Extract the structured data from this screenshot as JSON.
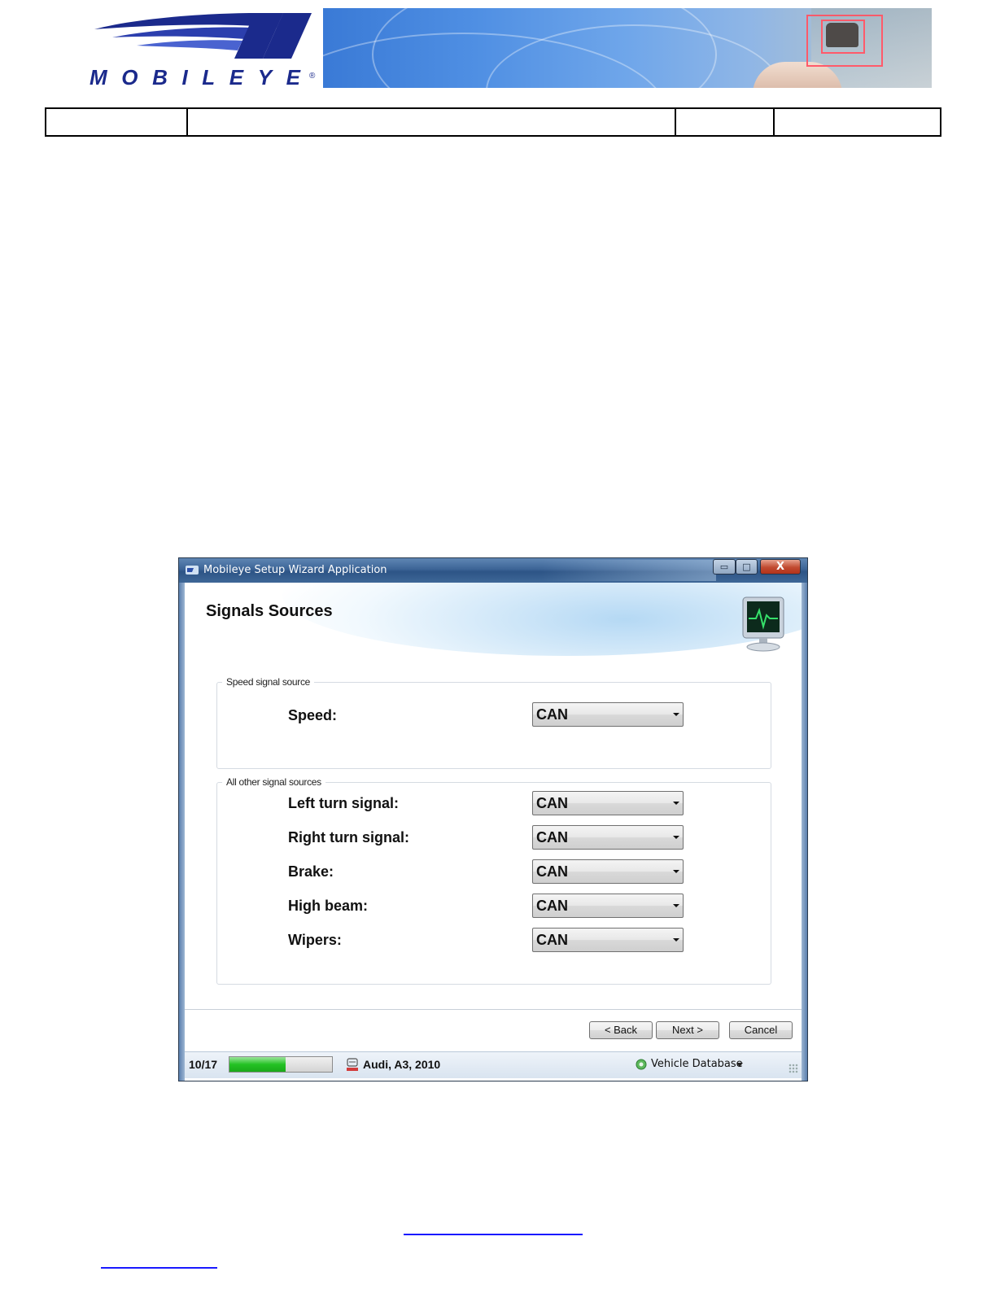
{
  "header": {
    "logo_text": "MOBILEYE",
    "info_table_cells": [
      "",
      "",
      "",
      ""
    ]
  },
  "window": {
    "title": "Mobileye Setup Wizard Application",
    "min_glyph": "▭",
    "max_glyph": "□",
    "close_glyph": "X",
    "page_title": "Signals Sources"
  },
  "speed_group": {
    "legend": "Speed signal source",
    "rows": [
      {
        "label": "Speed:",
        "value": "CAN"
      }
    ]
  },
  "other_group": {
    "legend": "All other signal sources",
    "rows": [
      {
        "label": "Left turn signal:",
        "value": "CAN"
      },
      {
        "label": "Right turn signal:",
        "value": "CAN"
      },
      {
        "label": "Brake:",
        "value": "CAN"
      },
      {
        "label": "High beam:",
        "value": "CAN"
      },
      {
        "label": "Wipers:",
        "value": "CAN"
      }
    ]
  },
  "buttons": {
    "back": "< Back",
    "next": "Next >",
    "cancel": "Cancel"
  },
  "status": {
    "step": "10/17",
    "progress_fraction": 0.55,
    "vehicle": "Audi, A3, 2010",
    "database": "Vehicle Database"
  },
  "colors": {
    "title_bar": "#3c6496",
    "progress_green": "#24c224",
    "link_blue": "#1a1aff"
  }
}
